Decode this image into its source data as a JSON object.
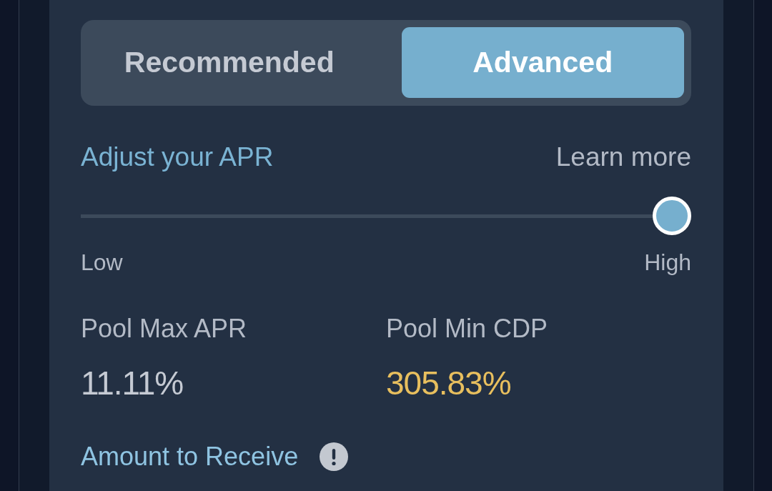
{
  "toggle": {
    "tabs": [
      {
        "label": "Recommended",
        "selected": false
      },
      {
        "label": "Advanced",
        "selected": true
      }
    ]
  },
  "apr": {
    "title": "Adjust your APR",
    "link": "Learn more",
    "slider": {
      "level": 1,
      "min_label": "Low",
      "max_label": "High"
    }
  },
  "stats": [
    {
      "label": "Pool Max APR",
      "value": "11.11%",
      "color": "#c5cad3"
    },
    {
      "label": "Pool Min CDP",
      "value": "305.83%",
      "color": "#e8bf5e"
    }
  ],
  "receive": {
    "label": "Amount to Receive"
  }
}
